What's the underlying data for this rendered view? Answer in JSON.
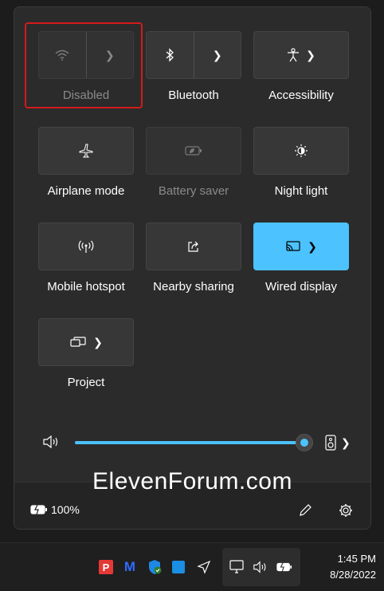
{
  "quick_settings": {
    "tiles": [
      {
        "label": "Disabled",
        "icon": "wifi-icon",
        "state": "disabled-split"
      },
      {
        "label": "Bluetooth",
        "icon": "bluetooth-icon",
        "state": "split"
      },
      {
        "label": "Accessibility",
        "icon": "accessibility-icon",
        "state": "normal"
      },
      {
        "label": "Airplane mode",
        "icon": "airplane-icon",
        "state": "normal"
      },
      {
        "label": "Battery saver",
        "icon": "battery-saver-icon",
        "state": "disabled"
      },
      {
        "label": "Night light",
        "icon": "night-light-icon",
        "state": "normal"
      },
      {
        "label": "Mobile hotspot",
        "icon": "hotspot-icon",
        "state": "normal"
      },
      {
        "label": "Nearby sharing",
        "icon": "share-icon",
        "state": "normal"
      },
      {
        "label": "Wired display",
        "icon": "cast-icon",
        "state": "active"
      },
      {
        "label": "Project",
        "icon": "project-icon",
        "state": "normal"
      }
    ],
    "volume": {
      "level_percent": 100
    },
    "battery_text": "100%",
    "watermark": "ElevenForum.com",
    "accent_color": "#4cc2ff",
    "highlight_color": "#d31a1a"
  },
  "taskbar": {
    "time": "1:45 PM",
    "date": "8/28/2022"
  }
}
